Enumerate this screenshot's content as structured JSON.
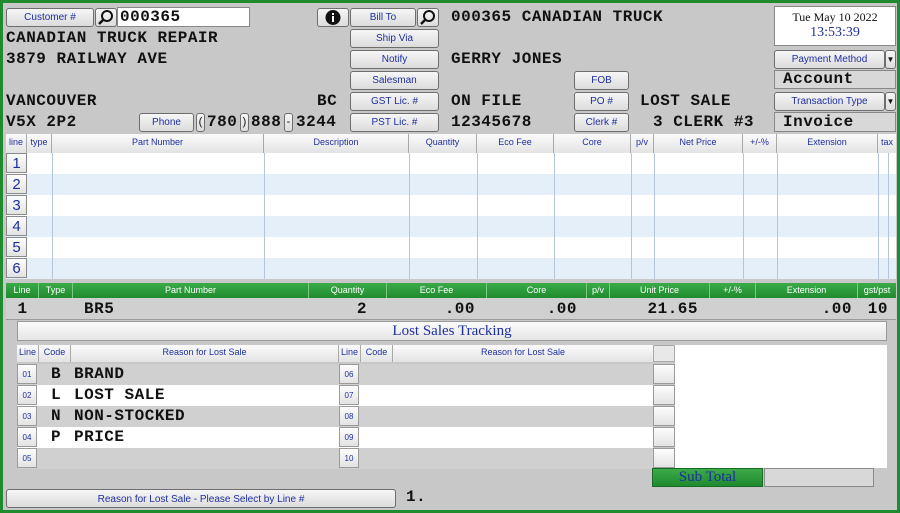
{
  "header": {
    "customer_btn": "Customer #",
    "customer_no": "000365",
    "name": "CANADIAN TRUCK REPAIR",
    "address": "3879 RAILWAY AVE",
    "city": "VANCOUVER",
    "province": "BC",
    "postal": "V5X 2P2",
    "phone_btn": "Phone",
    "phone_area": "780",
    "phone_prefix": "888",
    "phone_line": "3244",
    "paren_open": "(",
    "paren_close": ")",
    "dash": "-",
    "bill_to_btn": "Bill To",
    "ship_via_btn": "Ship Via",
    "notify_btn": "Notify",
    "salesman_btn": "Salesman",
    "gst_btn": "GST Lic. #",
    "pst_btn": "PST Lic. #",
    "bill_to_value": "000365 CANADIAN TRUCK",
    "contact": "GERRY JONES",
    "gst_value": "ON FILE",
    "pst_value": "12345678",
    "fob_btn": "FOB",
    "po_btn": "PO #",
    "clerk_btn": "Clerk #",
    "po_value": "LOST SALE",
    "clerk_value": "3 CLERK #3",
    "date": "Tue May 10 2022",
    "time": "13:53:39",
    "payment_method_btn": "Payment Method",
    "payment_method_value": "Account",
    "transaction_type_btn": "Transaction Type",
    "transaction_type_value": "Invoice"
  },
  "items_table": {
    "headers": [
      "line",
      "type",
      "Part Number",
      "Description",
      "Quantity",
      "Eco Fee",
      "Core",
      "p/v",
      "Net Price",
      "+/-%",
      "Extension",
      "tax"
    ],
    "rows": [
      "1",
      "2",
      "3",
      "4",
      "5",
      "6"
    ]
  },
  "detail": {
    "headers": [
      "Line",
      "Type",
      "Part Number",
      "Quantity",
      "Eco Fee",
      "Core",
      "p/v",
      "Unit Price",
      "+/-%",
      "Extension",
      "gst/pst"
    ],
    "line": "1",
    "part_number": "BR5",
    "quantity": "2",
    "eco_fee": ".00",
    "core": ".00",
    "unit_price": "21.65",
    "extension": ".00",
    "gst_pst": "10"
  },
  "lost_sales": {
    "title": "Lost Sales Tracking",
    "headers_left": [
      "Line",
      "Code",
      "Reason for Lost Sale"
    ],
    "headers_right": [
      "Line",
      "Code",
      "Reason for Lost Sale"
    ],
    "left_rows": [
      {
        "line": "01",
        "code": "B",
        "reason": "BRAND"
      },
      {
        "line": "02",
        "code": "L",
        "reason": "LOST SALE"
      },
      {
        "line": "03",
        "code": "N",
        "reason": "NON-STOCKED"
      },
      {
        "line": "04",
        "code": "P",
        "reason": "PRICE"
      },
      {
        "line": "05",
        "code": "",
        "reason": ""
      }
    ],
    "right_rows": [
      {
        "line": "06"
      },
      {
        "line": "07"
      },
      {
        "line": "08"
      },
      {
        "line": "09"
      },
      {
        "line": "10"
      }
    ],
    "subtotal_label": "Sub Total",
    "prompt_label": "Reason for Lost Sale - Please Select by Line #",
    "prompt_value": "1."
  },
  "colors": {
    "accent_green": "#1f8a2e",
    "button_text": "#1e2fa0",
    "row_stripe": "#e4effa"
  }
}
